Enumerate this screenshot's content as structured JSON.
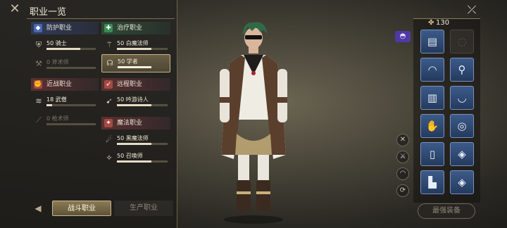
{
  "panel": {
    "title": "职业一览",
    "close_icon": "close-icon"
  },
  "categories": {
    "tank": "防护职业",
    "healer": "治疗职业",
    "melee": "近战职业",
    "ranged": "远程职业",
    "caster": "魔法职业"
  },
  "jobs": {
    "paladin": {
      "label": "50 骑士",
      "progress": 0.68
    },
    "marauder": {
      "label": "0 斧术师",
      "progress": 0
    },
    "whitemage": {
      "label": "50 白魔法师",
      "progress": 0.68
    },
    "scholar": {
      "label": "50 学者",
      "progress": 0.68
    },
    "monk": {
      "label": "18 武僧",
      "progress": 0.12
    },
    "lancer": {
      "label": "0 枪术师",
      "progress": 0
    },
    "bard": {
      "label": "50 吟游诗人",
      "progress": 0.68
    },
    "blackmage": {
      "label": "50 黑魔法师",
      "progress": 0.68
    },
    "summoner": {
      "label": "50 召唤师",
      "progress": 0.68
    }
  },
  "tabs": {
    "combat": "战斗职业",
    "crafting": "生产职业"
  },
  "gear": {
    "item_level": "130",
    "best_equipment": "最强装备"
  },
  "colors": {
    "accent": "#c5b68b",
    "slot_blue": "#3c5b8a"
  }
}
